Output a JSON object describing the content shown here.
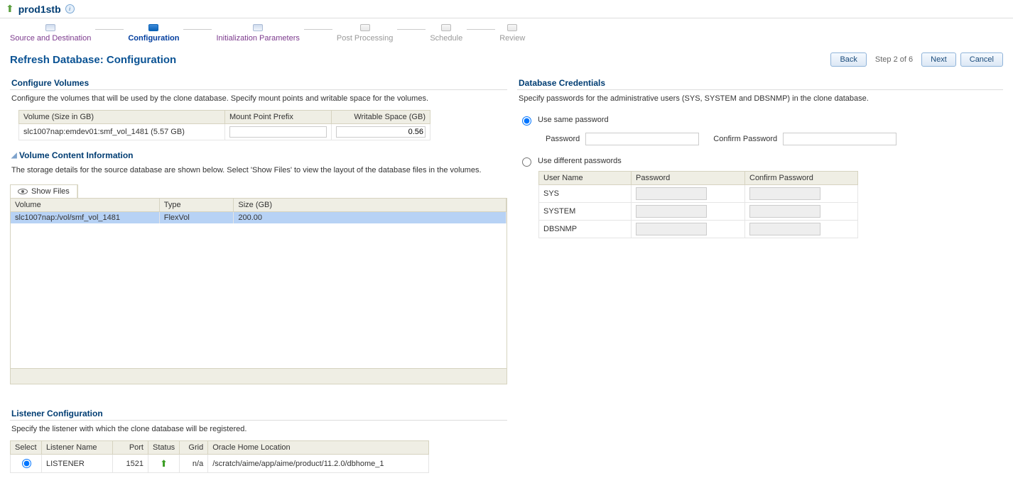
{
  "header": {
    "db_name": "prod1stb"
  },
  "wizard": {
    "steps": [
      {
        "label": "Source and Destination",
        "state": "done"
      },
      {
        "label": "Configuration",
        "state": "current"
      },
      {
        "label": "Initialization Parameters",
        "state": "done"
      },
      {
        "label": "Post Processing",
        "state": "pending"
      },
      {
        "label": "Schedule",
        "state": "pending"
      },
      {
        "label": "Review",
        "state": "pending"
      }
    ]
  },
  "page": {
    "title": "Refresh Database: Configuration",
    "back": "Back",
    "step_text": "Step 2 of 6",
    "next": "Next",
    "cancel": "Cancel"
  },
  "configure_volumes": {
    "heading": "Configure Volumes",
    "description": "Configure the volumes that will be used by the clone database. Specify mount points and writable space for the volumes.",
    "cols": {
      "volume": "Volume (Size in GB)",
      "mount": "Mount Point Prefix",
      "writable": "Writable Space (GB)"
    },
    "rows": [
      {
        "volume": "slc1007nap:emdev01:smf_vol_1481 (5.57 GB)",
        "mount": "",
        "writable": "0.56"
      }
    ]
  },
  "volume_content": {
    "heading": "Volume Content Information",
    "description": "The storage details for the source database are shown below. Select 'Show Files' to view the layout of the database files in the volumes.",
    "show_files": "Show Files",
    "cols": {
      "volume": "Volume",
      "type": "Type",
      "size": "Size (GB)"
    },
    "rows": [
      {
        "volume": "slc1007nap:/vol/smf_vol_1481",
        "type": "FlexVol",
        "size": "200.00"
      }
    ]
  },
  "listener": {
    "heading": "Listener Configuration",
    "description": "Specify the listener with which the clone database will be registered.",
    "cols": {
      "select": "Select",
      "name": "Listener Name",
      "port": "Port",
      "status": "Status",
      "grid": "Grid",
      "home": "Oracle Home Location"
    },
    "rows": [
      {
        "name": "LISTENER",
        "port": "1521",
        "grid": "n/a",
        "home": "/scratch/aime/app/aime/product/11.2.0/dbhome_1",
        "selected": true
      }
    ]
  },
  "credentials": {
    "heading": "Database Credentials",
    "description": "Specify passwords for the administrative users (SYS, SYSTEM and DBSNMP) in the clone database.",
    "same_label": "Use same password",
    "diff_label": "Use different passwords",
    "password_label": "Password",
    "confirm_label": "Confirm Password",
    "cols": {
      "user": "User Name",
      "password": "Password",
      "confirm": "Confirm Password"
    },
    "users": [
      "SYS",
      "SYSTEM",
      "DBSNMP"
    ]
  }
}
